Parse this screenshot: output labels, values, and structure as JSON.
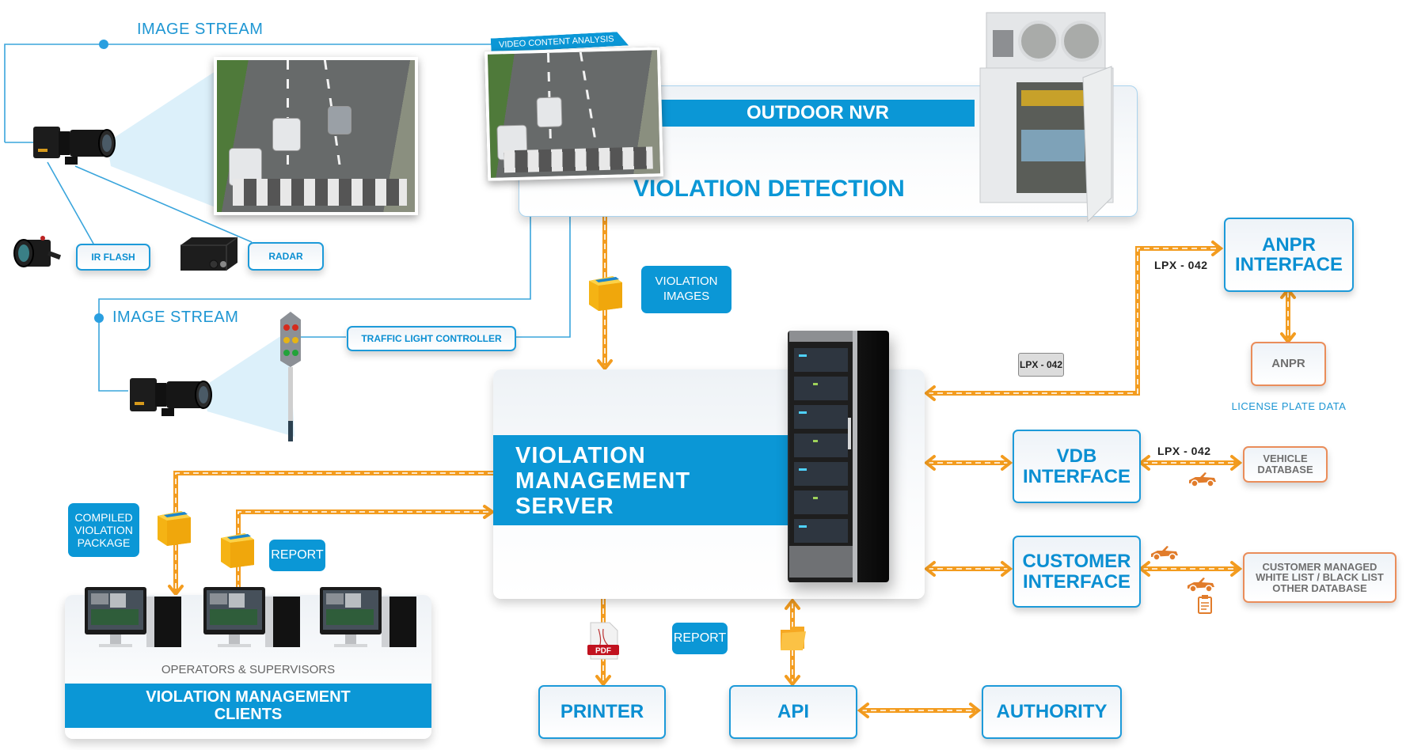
{
  "colors": {
    "accent_blue": "#0b97d6",
    "link_blue": "#1e96d3",
    "data_flow_orange": "#f39c1f",
    "external_border_orange": "#ea8d5a",
    "muted_text": "#6f6f6f"
  },
  "capture": {
    "image_stream_top": "IMAGE STREAM",
    "image_stream_bottom": "IMAGE STREAM",
    "ir_flash": "IR FLASH",
    "radar": "RADAR",
    "traffic_light_controller": "TRAFFIC LIGHT CONTROLLER",
    "video_content_analysis": "VIDEO CONTENT ANALYSIS"
  },
  "detection": {
    "outdoor_nvr": "OUTDOOR NVR",
    "violation_detection": "VIOLATION DETECTION",
    "violation_images": [
      "VIOLATION",
      "IMAGES"
    ]
  },
  "server": {
    "title_lines": [
      "VIOLATION",
      "MANAGEMENT",
      "SERVER"
    ]
  },
  "clients": {
    "compiled_package": [
      "COMPILED",
      "VIOLATION",
      "PACKAGE"
    ],
    "report": "REPORT",
    "operators": "OPERATORS & SUPERVISORS",
    "title_lines": [
      "VIOLATION MANAGEMENT",
      "CLIENTS"
    ]
  },
  "outputs": {
    "report": "REPORT",
    "pdf": "PDF",
    "printer": "PRINTER",
    "api": "API",
    "authority": "AUTHORITY"
  },
  "interfaces": {
    "anpr_interface": [
      "ANPR",
      "INTERFACE"
    ],
    "anpr": "ANPR",
    "license_plate_data": "LICENSE PLATE DATA",
    "plate_text_1": "LPX - 042",
    "plate_badge": "LPX - 042",
    "plate_text_2": "LPX - 042",
    "vdb_interface": [
      "VDB",
      "INTERFACE"
    ],
    "vehicle_database": [
      "VEHICLE",
      "DATABASE"
    ],
    "customer_interface": [
      "CUSTOMER",
      "INTERFACE"
    ],
    "customer_managed": [
      "CUSTOMER MANAGED",
      "WHITE LIST / BLACK LIST",
      "OTHER DATABASE"
    ]
  }
}
